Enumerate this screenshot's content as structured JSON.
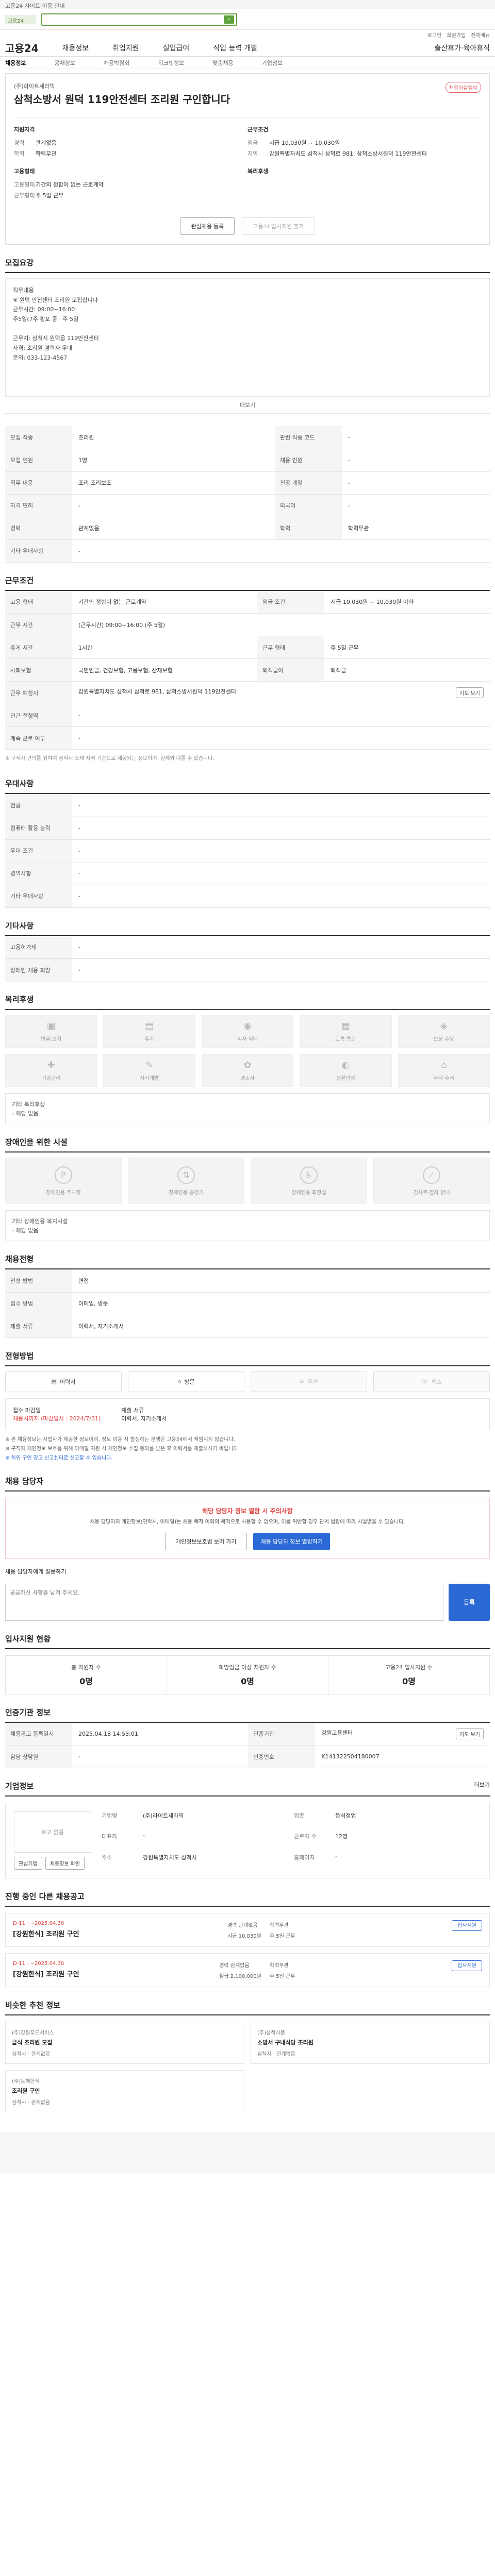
{
  "top_notice": "고용24 사이트 이용 안내",
  "brand": {
    "logo_text": "고용24",
    "search_placeholder": "",
    "search_label": "검색"
  },
  "utility": [
    "로그인",
    "회원가입",
    "전체메뉴"
  ],
  "gnb": {
    "logo": "고용24",
    "menus": [
      "채용정보",
      "취업지원",
      "실업급여",
      "직업 능력 개발"
    ],
    "right_menu": "출산휴가·육아휴직"
  },
  "subnav": [
    "채용정보",
    "공채정보",
    "채용박람회",
    "워크넷정보",
    "맞춤채용",
    "기업정보"
  ],
  "job": {
    "company": "(주)라이트세라믹",
    "title": "삼척소방서 원덕 119안전센터 조리원 구인합니다",
    "badge": "채용마감임박",
    "left_title": "지원자격",
    "left": [
      {
        "k": "경력",
        "v": "관계없음"
      },
      {
        "k": "학력",
        "v": "학력무관"
      }
    ],
    "mid_title": "근무조건",
    "mid": [
      {
        "k": "임금",
        "v": "시급 10,030원 ~ 10,030원"
      },
      {
        "k": "지역",
        "v": "강원특별자치도 삼척시 삼척로 981, 삼척소방서원덕 119안전센터"
      }
    ],
    "left2_title": "고용형태",
    "left2": [
      {
        "k": "고용형태",
        "v": "기간의 정함이 없는 근로계약"
      },
      {
        "k": "근무형태",
        "v": "주 5일 근무"
      }
    ],
    "mid2_title": "복리후생",
    "btn_scrap": "관심채용 등록",
    "btn_apply": "고용24 입사지원 불가"
  },
  "sections": {
    "desc_title": "모집요강",
    "desc_text": "직무내용\n※ 원덕 안전센터 조리원 모집합니다\n근무시간: 09:00~16:00\n주5일(7주 횡포 중 · 주 5일\n\n근무지: 삼척시 원덕읍 119안전센터\n자격: 조리원 경력자 우대\n문의: 033-123-4567",
    "more": "더보기",
    "req_title": "모집요강",
    "req_rows": [
      [
        "모집 직종",
        "조리원",
        "관련 직종 코드",
        "-"
      ],
      [
        "모집 인원",
        "1명",
        "채용 인원",
        "-"
      ],
      [
        "직무 내용",
        "조리·조리보조",
        "전공 계열",
        "-"
      ],
      [
        "자격 면허",
        "-",
        "외국어",
        "-"
      ],
      [
        "경력",
        "관계없음",
        "학력",
        "학력무관"
      ],
      [
        "기타 우대사항",
        "-",
        "",
        ""
      ]
    ],
    "cond_title": "근무조건",
    "cond_rows": [
      [
        "고용 형태",
        "기간의 정함이 없는 근로계약",
        "임금 조건",
        "시급 10,030원 ~ 10,030원 이하"
      ],
      [
        "근무 시간",
        "(근무시간) 09:00~16:00 (주 5일)",
        "",
        ""
      ],
      [
        "휴게 시간",
        "1시간",
        "근무 형태",
        "주 5일 근무"
      ],
      [
        "사회보험",
        "국민연금, 건강보험, 고용보험, 산재보험",
        "퇴직급여",
        "퇴직금"
      ],
      [
        "근무 예정지",
        "강원특별자치도 삼척시 삼척로 981, 삼척소방서원덕 119안전센터",
        "",
        ""
      ],
      [
        "인근 전철역",
        "-",
        "",
        ""
      ],
      [
        "계속 근로 여부",
        "-",
        "",
        ""
      ]
    ],
    "cond_pill": "지도 보기",
    "cond_note": "※ 구직자 편의를 위하여 삼척시 소재 지역 기준으로 제공되는 정보이며, 실제와 다를 수 있습니다.",
    "svc_title": "우대사항",
    "svc_rows": [
      [
        "전공",
        "-"
      ],
      [
        "컴퓨터 활용 능력",
        "-"
      ],
      [
        "우대 조건",
        "-"
      ],
      [
        "병역사항",
        "-"
      ],
      [
        "기타 우대사항",
        "-"
      ]
    ],
    "etc_title": "기타사항",
    "etc_rows": [
      [
        "고용허가제",
        "-"
      ],
      [
        "장애인 채용 희망",
        "-"
      ]
    ],
    "bene_title": "복리후생",
    "bene_icons": [
      "연금·보험",
      "휴가",
      "식사·식대",
      "교통·통근",
      "보상·수당",
      "건강관리",
      "자기개발",
      "경조사",
      "생활안정",
      "주택·주거"
    ],
    "bene_text": "기타 복리후생\n- 해당 없음",
    "dis_title": "장애인을 위한 시설",
    "dis_icons": [
      "장애인용 주차장",
      "장애인용 승강기",
      "장애인용 화장실",
      "경사로·점자 안내"
    ],
    "dis_text": "기타 장애인용 복지시설\n- 해당 없음",
    "proc_title": "채용전형",
    "proc_rows": [
      [
        "전형 방법",
        "면접"
      ],
      [
        "접수 방법",
        "이메일, 방문"
      ],
      [
        "제출 서류",
        "이력서, 자기소개서"
      ]
    ],
    "apply_title": "전형방법",
    "apply_cards": [
      "이력서",
      "방문",
      "우편",
      "팩스"
    ],
    "docs_left_title": "접수 마감일",
    "docs_left_val": "채용시까지 (마감일시 : 2024/7/31)",
    "docs_right_title": "제출 서류",
    "docs_right_val": "이력서, 자기소개서",
    "bullets": [
      "※ 본 채용정보는 사업자가 제공한 정보이며, 정보 이용 시 발생하는 분쟁은 고용24에서 책임지지 않습니다.",
      "※ 구직자 개인정보 보호를 위해 이메일 지원 시 개인정보 수집 동의를 받은 후 이력서를 제출하시기 바랍니다.",
      "※ 허위 구인 광고 신고센터로 신고할 수 있습니다."
    ],
    "agent_title": "채용 담당자",
    "agent_t": "해당 담당자 정보 열람 시 주의사항",
    "agent_p": "채용 담당자의 개인정보(연락처, 이메일)는 채용 목적 이외의 목적으로 사용할 수 없으며, 이를 위반할 경우 관계 법령에 따라 처벌받을 수 있습니다.",
    "agent_btn1": "개인정보보호법 보러 가기",
    "agent_btn2": "채용 담당자 정보 열람하기",
    "qna_label": "채용 담당자에게 질문하기",
    "qna_placeholder": "궁금하신 사항을 남겨 주세요.",
    "qna_btn": "등록",
    "stats_title": "입사지원 현황",
    "stats": [
      {
        "label": "총 지원자 수",
        "n": "0명"
      },
      {
        "label": "희망임금 이상 지원자 수",
        "n": "0명"
      },
      {
        "label": "고용24 입사지원 수",
        "n": "0명"
      }
    ],
    "mgmt_title": "인증기관 정보",
    "mgmt_rows": [
      [
        "채용공고 등록일시",
        "2025.04.18 14:53:01",
        "인증기관",
        "강원고용센터"
      ],
      [
        "담당 상담원",
        "-",
        "인증번호",
        "K141322504180007"
      ]
    ],
    "mgmt_pill": "지도 보기",
    "comp_title": "기업정보",
    "comp_more": "더보기",
    "comp_logo": "로고 없음",
    "comp_info": [
      [
        "기업명",
        "(주)라이트세라믹",
        "업종",
        "음식점업"
      ],
      [
        "대표자",
        "-",
        "근로자 수",
        "12명"
      ],
      [
        "주소",
        "강원특별자치도 삼척시",
        "홈페이지",
        "-"
      ]
    ],
    "comp_btn1": "관심기업",
    "comp_btn2": "채용정보 확인",
    "other_title": "진행 중인 다른 채용공고",
    "other_jobs": [
      {
        "period": "D-11 · ~2025.04.30",
        "title": "[강원한식] 조리원 구인",
        "m": [
          "경력 관계없음",
          "학력무관",
          "시급 10,030원",
          "주 5일 근무"
        ],
        "btn": "입사지원"
      },
      {
        "period": "D-11 · ~2025.04.30",
        "title": "[강원한식] 조리원 구인",
        "m": [
          "경력 관계없음",
          "학력무관",
          "월급 2,100,000원",
          "주 5일 근무"
        ],
        "btn": "입사지원"
      }
    ],
    "rec_title": "비슷한 추천 정보",
    "rec": [
      {
        "co": "(주)강원푸드서비스",
        "tt": "급식 조리원 모집",
        "meta": "삼척시 · 관계없음"
      },
      {
        "co": "(주)삼척식품",
        "tt": "소방서 구내식당 조리원",
        "meta": "삼척시 · 관계없음"
      },
      {
        "co": "(주)동해한식",
        "tt": "조리원 구인",
        "meta": "삼척시 · 관계없음"
      }
    ]
  }
}
